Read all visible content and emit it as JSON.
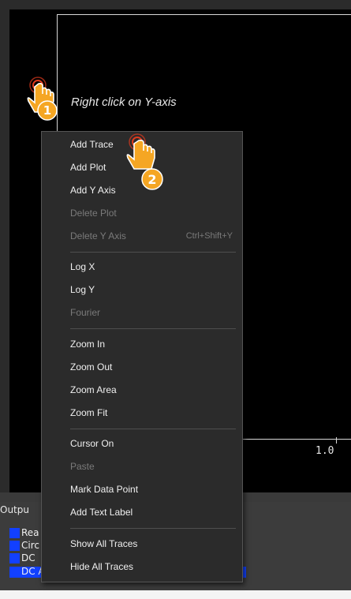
{
  "colors": {
    "plot_bg": "#000000",
    "menu_bg": "#2b2b2b",
    "disabled": "#7a7a7a",
    "log_marker": "#1240ff",
    "badge": "#f5a623"
  },
  "plot": {
    "x_tick_label": "1.0"
  },
  "annotation": {
    "step1_number": "1",
    "step1_text": "Right click on Y-axis",
    "step2_number": "2",
    "icon": "hand-pointer-icon"
  },
  "context_menu": {
    "items": [
      {
        "label": "Add Trace",
        "enabled": true
      },
      {
        "label": "Add Plot",
        "enabled": true
      },
      {
        "label": "Add Y Axis",
        "enabled": true
      },
      {
        "label": "Delete Plot",
        "enabled": false
      },
      {
        "label": "Delete Y Axis",
        "enabled": false,
        "shortcut": "Ctrl+Shift+Y"
      },
      {
        "label": "Log X",
        "enabled": true
      },
      {
        "label": "Log Y",
        "enabled": true
      },
      {
        "label": "Fourier",
        "enabled": false
      },
      {
        "label": "Zoom In",
        "enabled": true
      },
      {
        "label": "Zoom Out",
        "enabled": true
      },
      {
        "label": "Zoom Area",
        "enabled": true
      },
      {
        "label": "Zoom Fit",
        "enabled": true
      },
      {
        "label": "Cursor On",
        "enabled": true
      },
      {
        "label": "Paste",
        "enabled": false
      },
      {
        "label": "Mark Data Point",
        "enabled": true
      },
      {
        "label": "Add Text Label",
        "enabled": true
      },
      {
        "label": "Show All Traces",
        "enabled": true
      },
      {
        "label": "Hide All Traces",
        "enabled": true
      }
    ]
  },
  "output_panel": {
    "label": "Outpu",
    "lines": [
      "Rea",
      "Circ",
      "DC",
      "DC Analysis finished"
    ]
  }
}
